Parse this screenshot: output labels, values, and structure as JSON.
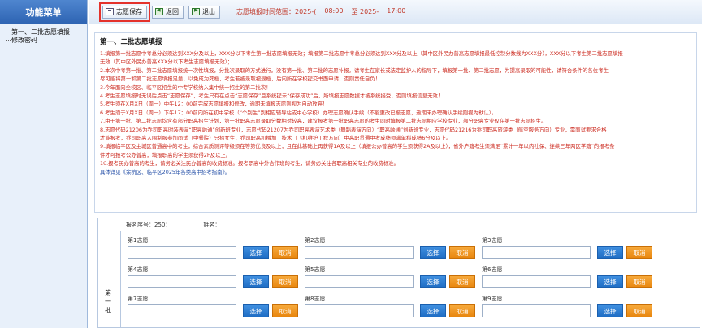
{
  "sidebar": {
    "title": "功能菜单",
    "items": [
      {
        "label": "第一、二批志愿填报"
      },
      {
        "label": "修改密码"
      }
    ]
  },
  "toolbar": {
    "save_label": "志愿保存",
    "back_label": "返回",
    "exit_label": "退出",
    "time_range_prefix": "志愿填报时间范围：2025-(",
    "time_start": "08:00",
    "time_to": "至 2025-",
    "time_end": "17:00"
  },
  "notice": {
    "title": "第一、二批志愿填报",
    "lines": [
      {
        "text": "1.填报第一批志愿中考总分必须达到XXX分及以上，XXX分以下考生第一批志愿填报无效；填报第二批志愿中考总分必须达到XXX分及以上（其中区外民办普高志愿填报最低控制分数线为XXX分），XXX分以下考生第二批志愿填报",
        "color": "red"
      },
      {
        "text": "无效（其中区外民办普高XXX分以下考生志愿填报无效）；",
        "color": "red"
      },
      {
        "text": "2.本次中考第一批、第二批志愿填报统一次性填报，分批次录取的方式进行。没有第一批、第二批的志愿补报。请考生在家长或法定监护人的指导下，填报第一批、第二批志愿，为提高录取的可能性，请符合条件的各位考生",
        "color": "red"
      },
      {
        "text": "尽可能将第一和第二批志愿填报足量，以免成为死档，考生若被录取被退档，后向所在学校提交书面申请，否则责任自负！",
        "color": "red"
      },
      {
        "text": "3.今年面向全校区、临平区招生的中专学校纳入集中统一招生的第二批次！",
        "color": "red"
      },
      {
        "text": "4.考生志愿填报时无误后点击“志愿保存”，考生只有在点击“志愿保存”且系统提示“保存成功”后，所填报志愿数据才被系统接受，否则填报信息无效！",
        "color": "red"
      },
      {
        "text": "5.考生须在X月X日（周一）中午12：00前完成志愿填报和修改，逾期未填报志愿则视为自动放弃！",
        "color": "red"
      },
      {
        "text": "6.考生须于X月X日（周一）下午17：00前向所在初中学校（“个别生”到相应辅导站或中心学校）办理志愿确认手续（不能更改已报志愿，逾期未办理确认手续则视为默认）。",
        "color": "red"
      },
      {
        "text": "7.由于第一批、第二批志愿均含有部分职高招生计划，第一批职高志愿录取分数相对较高，建议报考第一批职高志愿的考生同时填报第二批志愿相应学校专业，部分职高专业仅在第一批志愿招生。",
        "color": "red"
      },
      {
        "text": "8.志愿代码21206为乔司职高时装表演“职高融通”创新班专业，志愿代码21207为乔司职高表演艺术类（舞蹈表演方向）“职高融通”创新班专业，志愿代码21216为乔司职高旅游类（航空服务方向）专业，需面试要求合格",
        "color": "red"
      },
      {
        "text": "才能报考，乔司职高入围制服参加面试（中餐院）只招女生，乔司职高机械加工技术（飞机维护工程方向）中高职贯通中考成绩须满单科成绩6分及以上。",
        "color": "red"
      },
      {
        "text": "9.填报临平区及主城区普通高中的考生，综合素质测评等级须在等第优良及以上；且在此基础上再获得1A及以上（填报公办普高的学生须获得2A及以上），省外户籍考生须满足“累计一年以内社保、连续三年两区学籍”的报考条",
        "color": "red"
      },
      {
        "text": "件才可报考公办普高，填报职高的学生须获得2F及以上。",
        "color": "red"
      },
      {
        "text": "10.报考民办普高的考生，请务必关注民办普高的收费标准。报考职高中外合作班的考生，请务必关注各职高相关专业的收费标准。",
        "color": "red"
      },
      {
        "text": "具体详见《余杭区、临平区2025年各类高中招考指南》。",
        "color": "blue"
      }
    ]
  },
  "form": {
    "serial_label": "报名序号：250",
    "serial_sep": "：",
    "name_label": "姓名：",
    "batch_label": "第一批",
    "select_label": "选择",
    "cancel_label": "取消",
    "slots": [
      {
        "label": "第1志愿"
      },
      {
        "label": "第2志愿"
      },
      {
        "label": "第3志愿"
      },
      {
        "label": "第4志愿"
      },
      {
        "label": "第5志愿"
      },
      {
        "label": "第6志愿"
      },
      {
        "label": "第7志愿"
      },
      {
        "label": "第8志愿"
      },
      {
        "label": "第9志愿"
      }
    ]
  }
}
